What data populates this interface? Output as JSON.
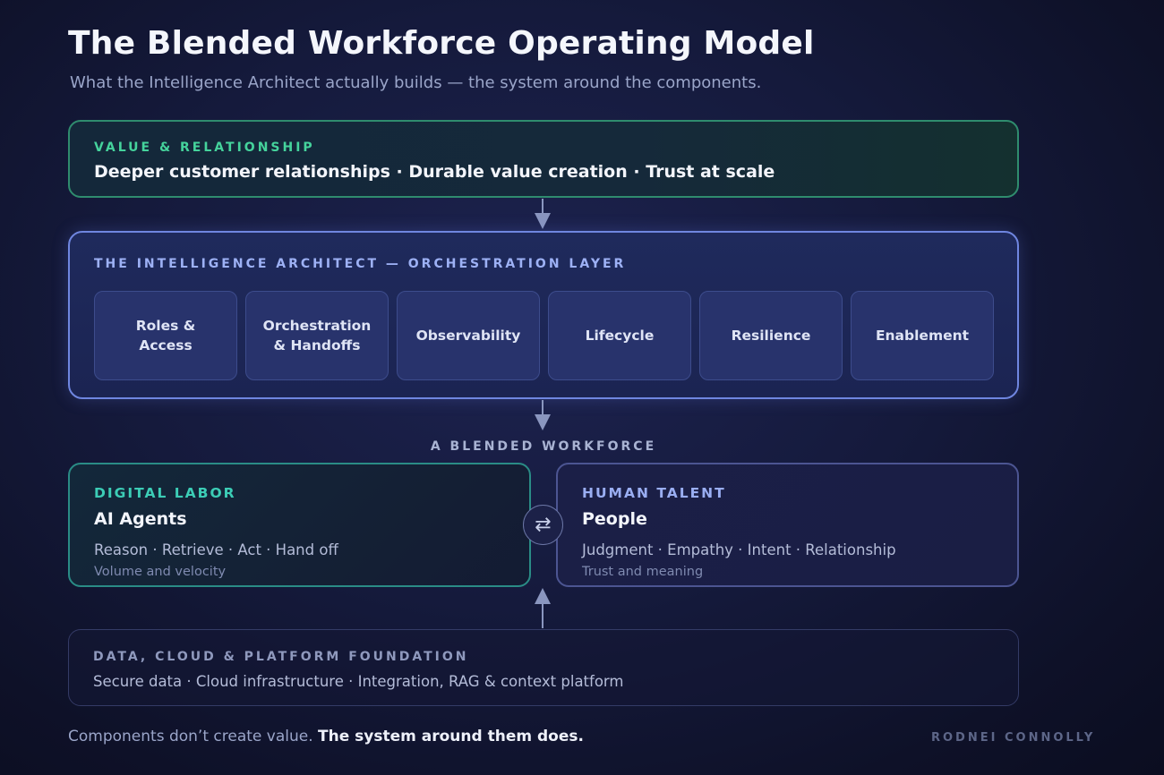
{
  "title": "The Blended Workforce Operating Model",
  "subtitle": "What the Intelligence Architect actually builds — the system around the components.",
  "value_layer": {
    "eyebrow": "VALUE & RELATIONSHIP",
    "headline": "Deeper customer relationships · Durable value creation · Trust at scale"
  },
  "orchestration_layer": {
    "eyebrow": "THE INTELLIGENCE ARCHITECT — ORCHESTRATION LAYER",
    "tiles": [
      {
        "line1": "Roles &",
        "line2": "Access"
      },
      {
        "line1": "Orchestration",
        "line2": "& Handoffs"
      },
      {
        "line1": "Observability",
        "line2": ""
      },
      {
        "line1": "Lifecycle",
        "line2": ""
      },
      {
        "line1": "Resilience",
        "line2": ""
      },
      {
        "line1": "Enablement",
        "line2": ""
      }
    ]
  },
  "workforce_label": "A BLENDED WORKFORCE",
  "digital_labor": {
    "eyebrow": "DIGITAL LABOR",
    "name": "AI Agents",
    "traits": "Reason · Retrieve · Act · Hand off",
    "note": "Volume and velocity",
    "accent": "#3ccdb6"
  },
  "human_talent": {
    "eyebrow": "HUMAN TALENT",
    "name": "People",
    "traits": "Judgment · Empathy · Intent · Relationship",
    "note": "Trust and meaning",
    "accent": "#9aaef2"
  },
  "swap_icon": "⇄",
  "foundation": {
    "eyebrow": "DATA, CLOUD & PLATFORM FOUNDATION",
    "items": "Secure data · Cloud infrastructure · Integration, RAG & context platform"
  },
  "footer": {
    "lead": "Components don’t create value.",
    "emphasis": "The system around them does."
  },
  "author": "RODNEI CONNOLLY",
  "icons": [
    "arrow-down-icon",
    "arrow-up-icon",
    "swap-arrows-icon"
  ]
}
